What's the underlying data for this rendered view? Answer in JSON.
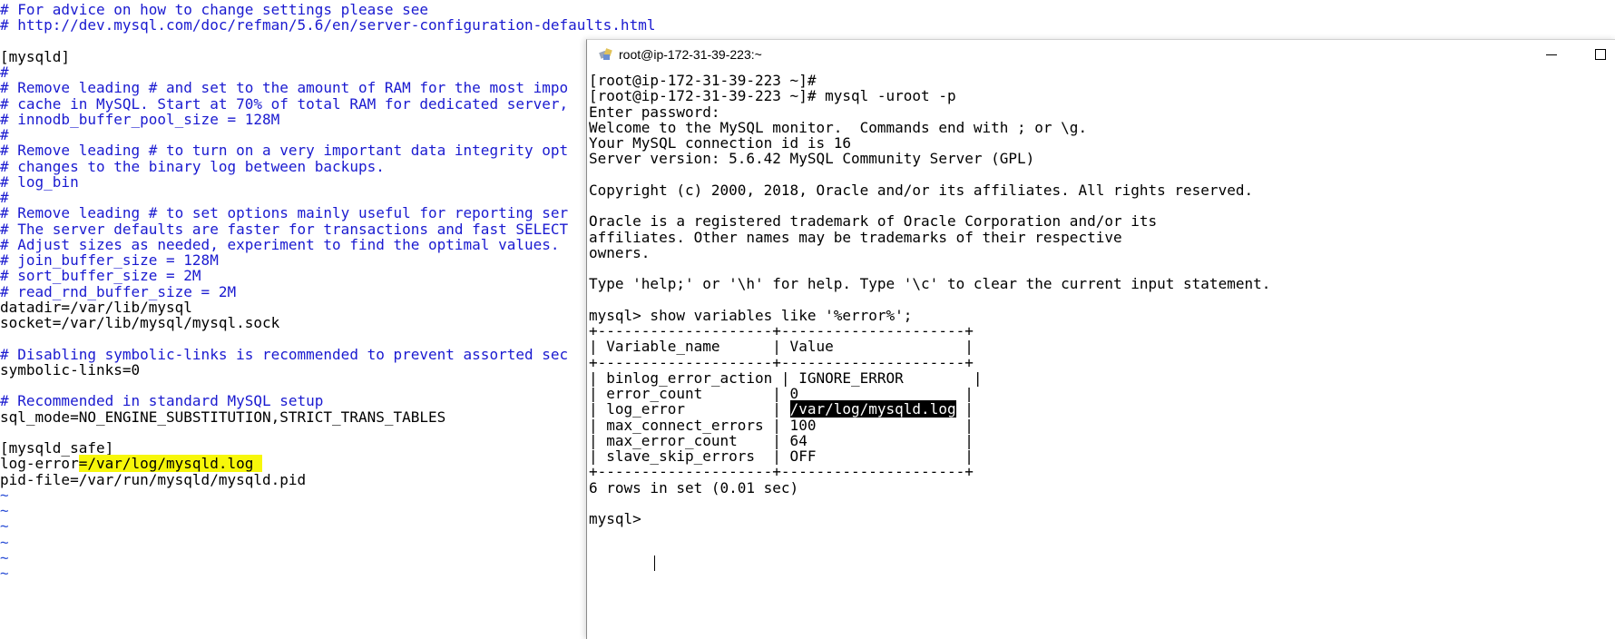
{
  "editor": {
    "lines": [
      {
        "text": "# For advice on how to change settings please see",
        "type": "comment"
      },
      {
        "text": "# http://dev.mysql.com/doc/refman/5.6/en/server-configuration-defaults.html",
        "type": "comment"
      },
      {
        "text": "",
        "type": "text"
      },
      {
        "text": "[mysqld]",
        "type": "text"
      },
      {
        "text": "#",
        "type": "comment"
      },
      {
        "text": "# Remove leading # and set to the amount of RAM for the most impo",
        "type": "comment"
      },
      {
        "text": "# cache in MySQL. Start at 70% of total RAM for dedicated server,",
        "type": "comment"
      },
      {
        "text": "# innodb_buffer_pool_size = 128M",
        "type": "comment"
      },
      {
        "text": "#",
        "type": "comment"
      },
      {
        "text": "# Remove leading # to turn on a very important data integrity opt",
        "type": "comment"
      },
      {
        "text": "# changes to the binary log between backups.",
        "type": "comment"
      },
      {
        "text": "# log_bin",
        "type": "comment"
      },
      {
        "text": "#",
        "type": "comment"
      },
      {
        "text": "# Remove leading # to set options mainly useful for reporting ser",
        "type": "comment"
      },
      {
        "text": "# The server defaults are faster for transactions and fast SELECT",
        "type": "comment"
      },
      {
        "text": "# Adjust sizes as needed, experiment to find the optimal values.",
        "type": "comment"
      },
      {
        "text": "# join_buffer_size = 128M",
        "type": "comment"
      },
      {
        "text": "# sort_buffer_size = 2M",
        "type": "comment"
      },
      {
        "text": "# read_rnd_buffer_size = 2M",
        "type": "comment"
      },
      {
        "text": "datadir=/var/lib/mysql",
        "type": "text"
      },
      {
        "text": "socket=/var/lib/mysql/mysql.sock",
        "type": "text"
      },
      {
        "text": "",
        "type": "text"
      },
      {
        "text": "# Disabling symbolic-links is recommended to prevent assorted sec",
        "type": "comment"
      },
      {
        "text": "symbolic-links=0",
        "type": "text"
      },
      {
        "text": "",
        "type": "text"
      },
      {
        "text": "# Recommended in standard MySQL setup",
        "type": "comment"
      },
      {
        "text": "sql_mode=NO_ENGINE_SUBSTITUTION,STRICT_TRANS_TABLES",
        "type": "text"
      },
      {
        "text": "",
        "type": "text"
      },
      {
        "text": "[mysqld_safe]",
        "type": "text"
      },
      {
        "text": "log-error",
        "type": "highlight",
        "highlight": "=/var/log/mysqld.log "
      },
      {
        "text": "pid-file=/var/run/mysqld/mysqld.pid",
        "type": "text"
      },
      {
        "text": "~",
        "type": "tilde"
      },
      {
        "text": "~",
        "type": "tilde"
      },
      {
        "text": "~",
        "type": "tilde"
      },
      {
        "text": "~",
        "type": "tilde"
      },
      {
        "text": "~",
        "type": "tilde"
      },
      {
        "text": "~",
        "type": "tilde"
      }
    ]
  },
  "terminal": {
    "title": "root@ip-172-31-39-223:~",
    "lines": [
      {
        "text": "[root@ip-172-31-39-223 ~]#"
      },
      {
        "text": "[root@ip-172-31-39-223 ~]# mysql -uroot -p"
      },
      {
        "text": "Enter password:"
      },
      {
        "text": "Welcome to the MySQL monitor.  Commands end with ; or \\g."
      },
      {
        "text": "Your MySQL connection id is 16"
      },
      {
        "text": "Server version: 5.6.42 MySQL Community Server (GPL)"
      },
      {
        "text": ""
      },
      {
        "text": "Copyright (c) 2000, 2018, Oracle and/or its affiliates. All rights reserved."
      },
      {
        "text": ""
      },
      {
        "text": "Oracle is a registered trademark of Oracle Corporation and/or its"
      },
      {
        "text": "affiliates. Other names may be trademarks of their respective"
      },
      {
        "text": "owners."
      },
      {
        "text": ""
      },
      {
        "text": "Type 'help;' or '\\h' for help. Type '\\c' to clear the current input statement."
      },
      {
        "text": ""
      },
      {
        "text": "mysql> show variables like '%error%';"
      },
      {
        "text": "+--------------------+---------------------+"
      },
      {
        "text": "| Variable_name      | Value               |"
      },
      {
        "text": "+--------------------+---------------------+"
      },
      {
        "text": "| binlog_error_action | IGNORE_ERROR        |"
      },
      {
        "text": "| error_count        | 0                   |"
      },
      {
        "text": "| log_error          | ",
        "sel": "/var/log/mysqld.log",
        "after": " |"
      },
      {
        "text": "| max_connect_errors | 100                 |"
      },
      {
        "text": "| max_error_count    | 64                  |"
      },
      {
        "text": "| slave_skip_errors  | OFF                 |"
      },
      {
        "text": "+--------------------+---------------------+"
      },
      {
        "text": "6 rows in set (0.01 sec)"
      },
      {
        "text": ""
      },
      {
        "text": "mysql> "
      }
    ]
  },
  "colors": {
    "comment": "#1a1ad0",
    "tilde": "#2b4fd6",
    "highlight": "#f7f70a"
  }
}
